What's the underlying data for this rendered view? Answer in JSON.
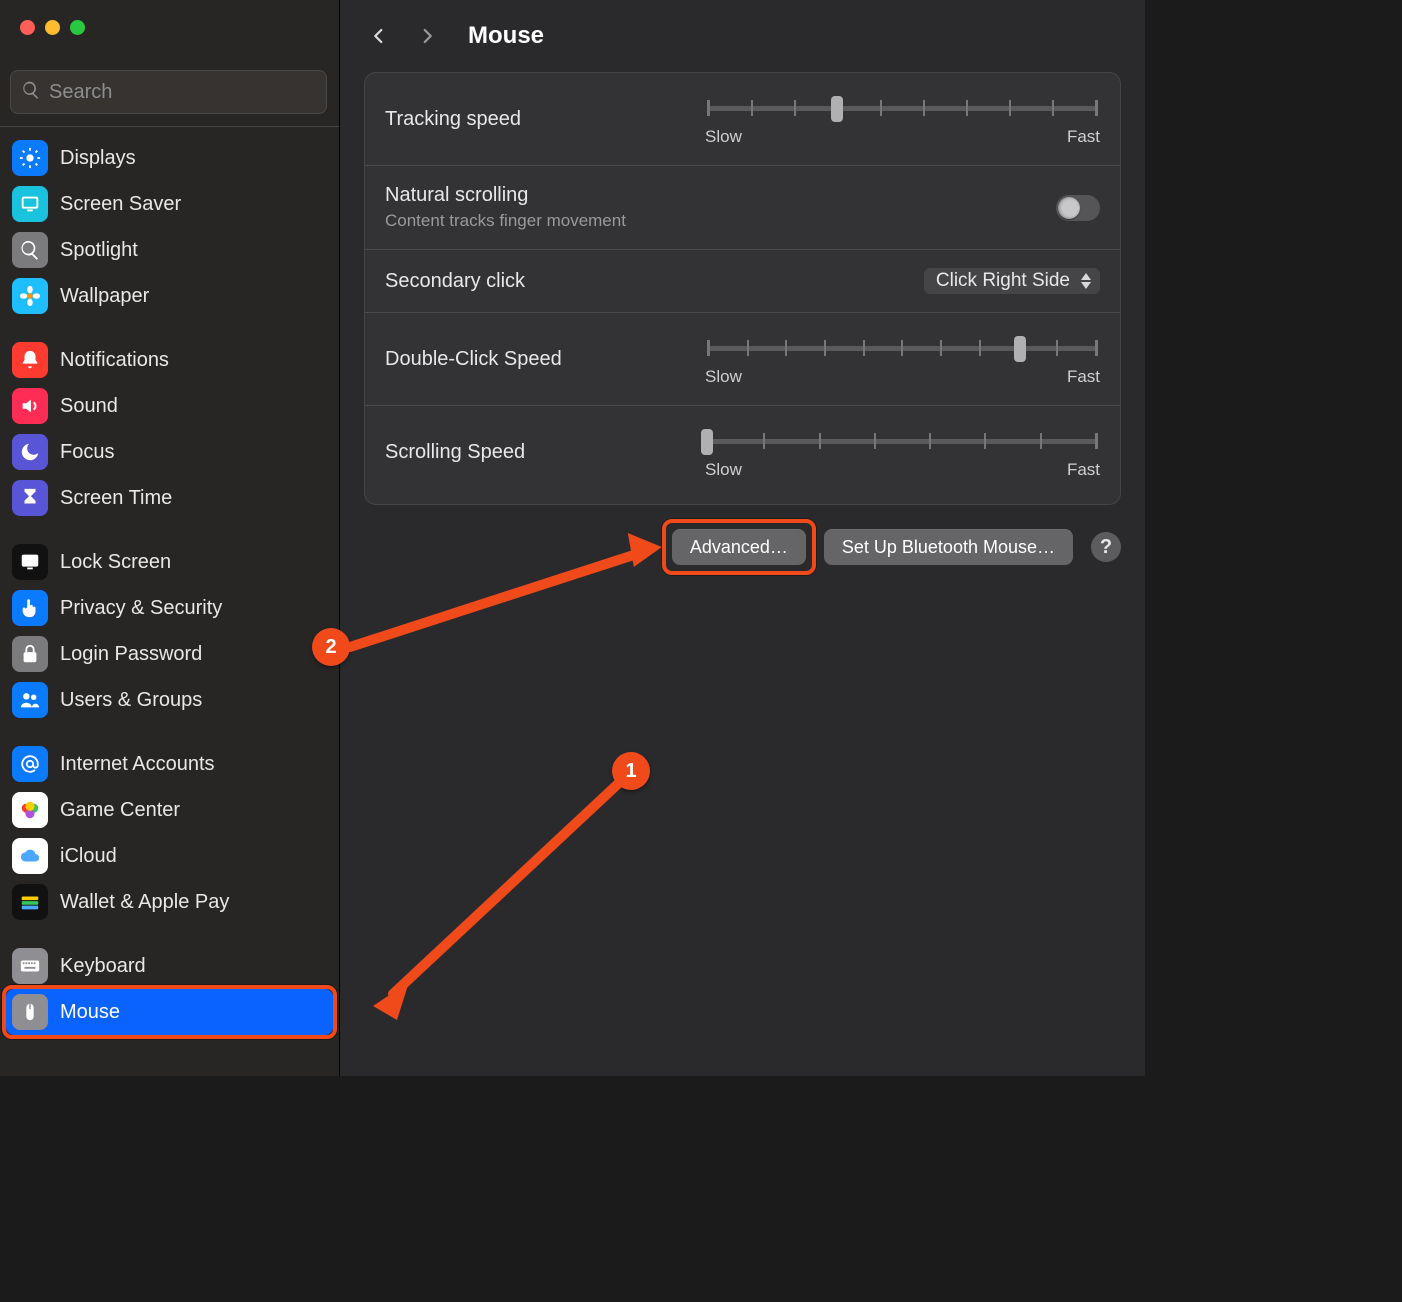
{
  "window": {
    "title": "Mouse"
  },
  "search": {
    "placeholder": "Search"
  },
  "sidebar": {
    "groups": [
      [
        {
          "label": "Displays",
          "icon": "sun",
          "bg": "#0a7aff"
        },
        {
          "label": "Screen Saver",
          "icon": "screensaver",
          "bg": "#19c3dd"
        },
        {
          "label": "Spotlight",
          "icon": "search",
          "bg": "#7b7b7d"
        },
        {
          "label": "Wallpaper",
          "icon": "flower",
          "bg": "#1fbeff"
        }
      ],
      [
        {
          "label": "Notifications",
          "icon": "bell",
          "bg": "#ff3b30"
        },
        {
          "label": "Sound",
          "icon": "speaker",
          "bg": "#ff2d55"
        },
        {
          "label": "Focus",
          "icon": "moon",
          "bg": "#5856d6"
        },
        {
          "label": "Screen Time",
          "icon": "hourglass",
          "bg": "#5856d6"
        }
      ],
      [
        {
          "label": "Lock Screen",
          "icon": "lock",
          "bg": "#111111"
        },
        {
          "label": "Privacy & Security",
          "icon": "hand",
          "bg": "#0a7aff"
        },
        {
          "label": "Login Password",
          "icon": "padlock",
          "bg": "#7b7b7d"
        },
        {
          "label": "Users & Groups",
          "icon": "users",
          "bg": "#0a7aff"
        }
      ],
      [
        {
          "label": "Internet Accounts",
          "icon": "at",
          "bg": "#0a7aff"
        },
        {
          "label": "Game Center",
          "icon": "gamecenter",
          "bg": "#ffffff"
        },
        {
          "label": "iCloud",
          "icon": "cloud",
          "bg": "#ffffff"
        },
        {
          "label": "Wallet & Apple Pay",
          "icon": "wallet",
          "bg": "#111111"
        }
      ],
      [
        {
          "label": "Keyboard",
          "icon": "keyboard",
          "bg": "#8e8e93"
        },
        {
          "label": "Mouse",
          "icon": "mouse",
          "bg": "#8e8e93",
          "selected": true
        }
      ]
    ]
  },
  "settings": {
    "tracking": {
      "label": "Tracking speed",
      "slow": "Slow",
      "fast": "Fast",
      "ticks": 10,
      "value_index": 3
    },
    "natural": {
      "label": "Natural scrolling",
      "sub": "Content tracks finger movement",
      "on": false
    },
    "secondary": {
      "label": "Secondary click",
      "value": "Click Right Side"
    },
    "doubleclick": {
      "label": "Double-Click Speed",
      "slow": "Slow",
      "fast": "Fast",
      "ticks": 11,
      "value_index": 8
    },
    "scrollspeed": {
      "label": "Scrolling Speed",
      "slow": "Slow",
      "fast": "Fast",
      "ticks": 8,
      "value_index": 0
    }
  },
  "footer": {
    "advanced": "Advanced…",
    "bluetooth": "Set Up Bluetooth Mouse…",
    "help": "?"
  },
  "annotations": {
    "badge1": "1",
    "badge2": "2"
  }
}
